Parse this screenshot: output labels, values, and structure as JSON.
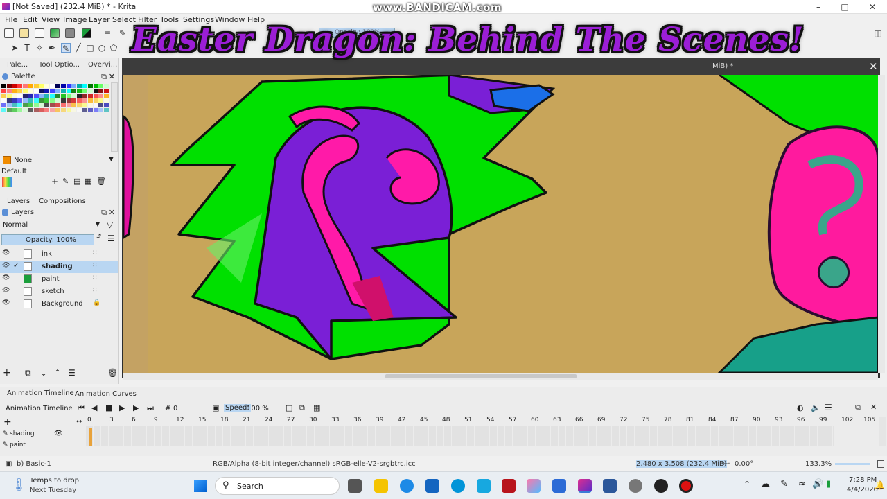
{
  "window": {
    "title": "[Not Saved]  (232.4 MiB) * - Krita",
    "watermark": "www.BANDICAM.com"
  },
  "overlay_text": "Easter Dragon: Behind The Scenes!",
  "menu": [
    "File",
    "Edit",
    "View",
    "Image",
    "Layer",
    "Select",
    "Filter",
    "Tools",
    "Settings",
    "Window",
    "Help"
  ],
  "toolbar": {
    "opacity_label": "Opacity: 100%"
  },
  "canvas_tab": {
    "title": "MiB) *"
  },
  "left_dock": {
    "tabs": [
      "Pale...",
      "Tool Optio...",
      "Overvi..."
    ],
    "palette": {
      "title": "Palette",
      "selected_color_name": "None",
      "palette_name": "Default"
    },
    "layers_tabs": [
      "Layers",
      "Compositions"
    ],
    "layers": {
      "title": "Layers",
      "blend_mode": "Normal",
      "opacity": "Opacity:  100%",
      "items": [
        {
          "name": "ink"
        },
        {
          "name": "shading"
        },
        {
          "name": "paint"
        },
        {
          "name": "sketch"
        },
        {
          "name": "Background"
        }
      ]
    }
  },
  "animation": {
    "tabs": [
      "Animation Timeline",
      "Animation Curves"
    ],
    "title": "Animation Timeline",
    "frame_hash": "#",
    "frame": "0",
    "speed_label": "Speed:",
    "speed_value": "100 %",
    "ruler": [
      "0",
      "3",
      "6",
      "9",
      "12",
      "15",
      "18",
      "21",
      "24",
      "27",
      "30",
      "33",
      "36",
      "39",
      "42",
      "45",
      "48",
      "51",
      "54",
      "57",
      "60",
      "63",
      "66",
      "69",
      "72",
      "75",
      "78",
      "81",
      "84",
      "87",
      "90",
      "93",
      "96",
      "99",
      "102",
      "105"
    ],
    "tracks": [
      "shading",
      "paint"
    ]
  },
  "status": {
    "brush": "b) Basic-1",
    "color_space": "RGB/Alpha (8-bit integer/channel)  sRGB-elle-V2-srgbtrc.icc",
    "dimensions": "2,480 x 3,508 (232.4 MiB)",
    "rotation": "0.00°",
    "zoom": "133.3%"
  },
  "taskbar": {
    "weather_line1": "Temps to drop",
    "weather_line2": "Next Tuesday",
    "search": "Search",
    "time": "7:28 PM",
    "date": "4/4/2026"
  },
  "colors": {
    "canvas_bg": "#c8a55a",
    "hair_green": "#00e000",
    "purple": "#7a1fd6",
    "pink": "#ff1aa8",
    "teal": "#17a089",
    "accent_blue": "#b9d6f2"
  }
}
